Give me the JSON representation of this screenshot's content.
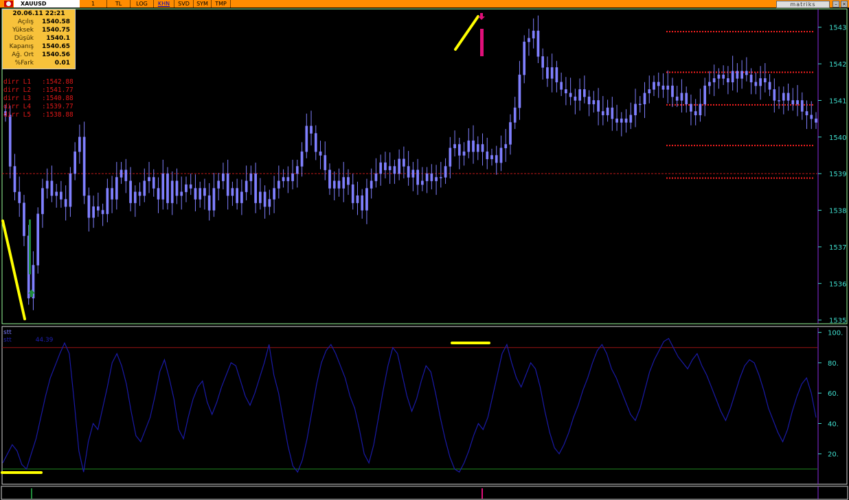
{
  "toolbar": {
    "symbol": "XAUUSD",
    "buttons": [
      {
        "label": "1",
        "active": false
      },
      {
        "label": "TL",
        "active": false
      },
      {
        "label": "LOG",
        "active": false
      },
      {
        "label": "KHN",
        "active": true
      },
      {
        "label": "SVD",
        "active": false
      },
      {
        "label": "SYM",
        "active": false
      },
      {
        "label": "TMP",
        "active": false
      }
    ],
    "logo": "matriks"
  },
  "info": {
    "datetime": "20.06.11 22:21",
    "rows": [
      {
        "label": "Açılış",
        "value": "1540.58"
      },
      {
        "label": "Yüksek",
        "value": "1540.75"
      },
      {
        "label": "Düşük",
        "value": "1540.1"
      },
      {
        "label": "Kapanış",
        "value": "1540.65"
      },
      {
        "label": "Ağ. Ort",
        "value": "1540.56"
      },
      {
        "label": "%Fark",
        "value": "0.01"
      }
    ]
  },
  "levels_list": [
    {
      "name": "dirr L1",
      "value": ":1542.88"
    },
    {
      "name": "dirr L2",
      "value": ":1541.77"
    },
    {
      "name": "dirr L3",
      "value": ":1540.88"
    },
    {
      "name": "dirr L4",
      "value": ":1539.77"
    },
    {
      "name": "dirr L5",
      "value": ":1538.88"
    }
  ],
  "indicator": {
    "title": "stt",
    "series_label": "stt",
    "value_text": "44.39"
  },
  "colors": {
    "background": "#000000",
    "candle": "#8080ff",
    "level": "#ff2020",
    "indicator_line": "#1a1aa8",
    "highlight": "#ffff00",
    "axis_text": "#40e0d0",
    "buy_arrow": "#1f8a3a",
    "sell_arrow": "#e0107a"
  },
  "chart_data": [
    {
      "type": "candlestick",
      "ylim": [
        1534.9,
        1543.5
      ],
      "yticks": [
        1535,
        1536,
        1537,
        1538,
        1539,
        1540,
        1541,
        1542,
        1543
      ],
      "ytick_labels": [
        "1535",
        "1536",
        "1537",
        "1538",
        "1539",
        "1540",
        "1541",
        "1542",
        "1543"
      ],
      "reference_level": 1539,
      "levels": [
        1542.88,
        1541.77,
        1540.88,
        1539.77,
        1538.88
      ],
      "closes": [
        1540.6,
        1539.2,
        1538.5,
        1538.2,
        1537.3,
        1535.6,
        1536.5,
        1537.9,
        1538.6,
        1538.8,
        1538.4,
        1538.5,
        1538.3,
        1538.1,
        1539.0,
        1539.6,
        1540.0,
        1538.4,
        1537.8,
        1538.1,
        1538.0,
        1537.9,
        1538.6,
        1538.3,
        1538.9,
        1539.1,
        1538.8,
        1538.2,
        1538.5,
        1538.4,
        1538.8,
        1538.9,
        1538.6,
        1538.3,
        1539.0,
        1538.2,
        1538.8,
        1538.4,
        1538.5,
        1538.7,
        1538.6,
        1538.3,
        1538.6,
        1538.4,
        1538.0,
        1538.6,
        1538.8,
        1539.0,
        1538.4,
        1538.6,
        1538.2,
        1538.5,
        1538.8,
        1539.0,
        1538.2,
        1538.5,
        1538.1,
        1538.3,
        1538.6,
        1538.8,
        1538.9,
        1538.8,
        1539.0,
        1539.2,
        1539.6,
        1540.3,
        1540.1,
        1539.6,
        1539.5,
        1539.1,
        1538.6,
        1538.8,
        1538.6,
        1538.9,
        1538.7,
        1538.2,
        1538.4,
        1538.0,
        1538.6,
        1538.8,
        1539.0,
        1539.3,
        1539.1,
        1539.2,
        1539.0,
        1539.4,
        1539.2,
        1538.9,
        1539.1,
        1538.7,
        1538.8,
        1539.0,
        1538.8,
        1538.9,
        1538.9,
        1539.2,
        1539.7,
        1539.8,
        1539.5,
        1539.6,
        1539.9,
        1539.6,
        1539.8,
        1539.6,
        1539.4,
        1539.5,
        1539.3,
        1539.7,
        1539.8,
        1540.4,
        1540.8,
        1541.7,
        1542.6,
        1542.7,
        1542.9,
        1542.2,
        1541.9,
        1541.6,
        1541.9,
        1541.5,
        1541.3,
        1541.2,
        1541.1,
        1541.0,
        1541.3,
        1541.1,
        1540.9,
        1541.0,
        1540.7,
        1540.6,
        1540.8,
        1540.5,
        1540.4,
        1540.5,
        1540.4,
        1540.6,
        1540.9,
        1540.9,
        1541.2,
        1541.3,
        1541.5,
        1541.4,
        1541.3,
        1541.4,
        1541.1,
        1541.0,
        1541.2,
        1540.9,
        1540.7,
        1540.6,
        1540.9,
        1541.4,
        1541.5,
        1541.6,
        1541.7,
        1541.6,
        1541.5,
        1541.8,
        1541.6,
        1541.8,
        1541.7,
        1541.5,
        1541.4,
        1541.6,
        1541.5,
        1541.3,
        1541.0,
        1541.0,
        1541.2,
        1541.0,
        1540.9,
        1541.0,
        1540.7,
        1540.6,
        1540.5,
        1540.4
      ]
    },
    {
      "type": "line",
      "ylim": [
        0,
        103
      ],
      "yticks": [
        20,
        40,
        60,
        80,
        100
      ],
      "ytick_labels": [
        "20.",
        "40.",
        "60.",
        "80.",
        "100."
      ],
      "upper_band": 90,
      "lower_band": 10,
      "values": [
        14,
        20,
        26,
        22,
        13,
        10,
        20,
        30,
        44,
        58,
        70,
        78,
        86,
        93,
        86,
        55,
        22,
        8,
        28,
        40,
        36,
        50,
        64,
        80,
        86,
        78,
        66,
        48,
        32,
        28,
        36,
        44,
        58,
        74,
        82,
        70,
        56,
        36,
        30,
        44,
        56,
        64,
        68,
        54,
        46,
        54,
        64,
        72,
        80,
        78,
        68,
        58,
        52,
        60,
        70,
        80,
        92,
        72,
        60,
        42,
        25,
        12,
        8,
        16,
        30,
        48,
        66,
        80,
        88,
        92,
        86,
        78,
        70,
        58,
        50,
        36,
        20,
        14,
        26,
        44,
        62,
        78,
        90,
        86,
        72,
        58,
        48,
        56,
        68,
        78,
        74,
        60,
        44,
        30,
        18,
        10,
        8,
        14,
        22,
        32,
        40,
        36,
        44,
        58,
        72,
        86,
        92,
        80,
        70,
        64,
        72,
        80,
        76,
        64,
        48,
        34,
        24,
        20,
        26,
        34,
        44,
        52,
        62,
        70,
        80,
        88,
        92,
        86,
        76,
        70,
        62,
        54,
        46,
        42,
        50,
        62,
        74,
        82,
        88,
        94,
        96,
        90,
        84,
        80,
        76,
        82,
        86,
        78,
        72,
        64,
        56,
        48,
        42,
        50,
        60,
        70,
        78,
        82,
        80,
        72,
        62,
        50,
        42,
        34,
        28,
        36,
        48,
        58,
        66,
        70,
        60,
        44
      ]
    }
  ]
}
